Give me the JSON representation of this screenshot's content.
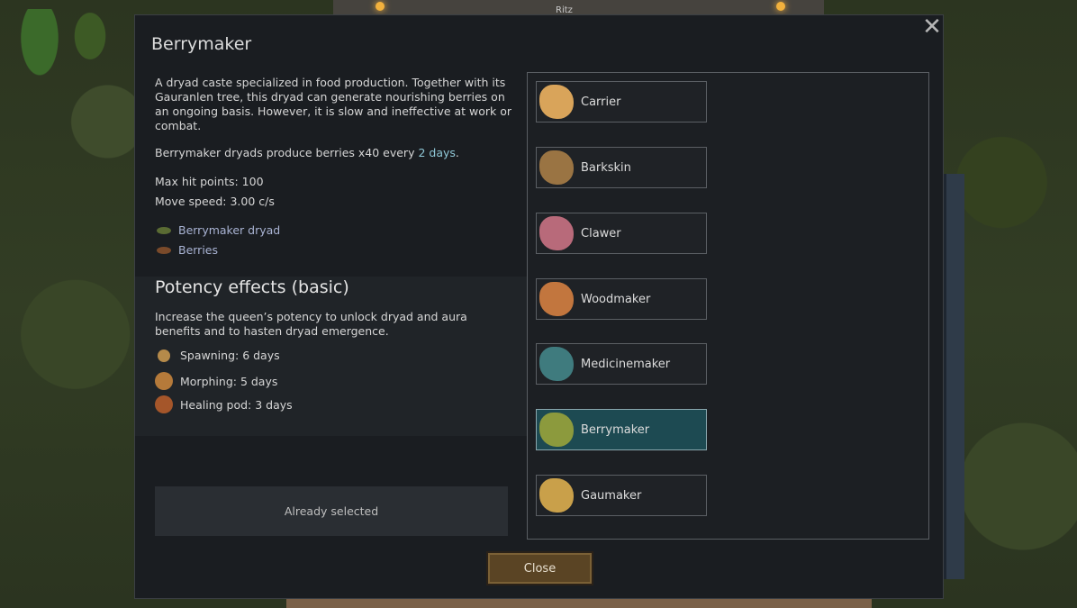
{
  "window": {
    "title": "Berrymaker",
    "close_glyph": "✕"
  },
  "background": {
    "pawn_name": "Ritz"
  },
  "details": {
    "description": "A dryad caste specialized in food production. Together with its Gauranlen tree, this dryad can generate nourishing berries on an ongoing basis. However, it is slow and ineffective at work or combat.",
    "produce_prefix": "Berrymaker dryads produce berries x40 every ",
    "produce_interval": "2 days",
    "produce_suffix": ".",
    "max_hp": "Max hit points: 100",
    "move_speed": "Move speed: 3.00 c/s",
    "links": [
      {
        "label": "Berrymaker dryad",
        "icon": "dryad-icon",
        "color": "#5a6b33"
      },
      {
        "label": "Berries",
        "icon": "berries-icon",
        "color": "#7a4a2a"
      }
    ]
  },
  "potency": {
    "title": "Potency effects (basic)",
    "description": "Increase the queen’s potency to unlock dryad and aura benefits and to hasten dryad emergence.",
    "effects": [
      {
        "label": "Spawning: 6 days",
        "icon": "spawning-icon",
        "color": "#b58a4a"
      },
      {
        "label": "Morphing: 5 days",
        "icon": "morphing-icon",
        "color": "#b57a3a"
      },
      {
        "label": "Healing pod: 3 days",
        "icon": "healing-pod-icon",
        "color": "#a5562a"
      }
    ]
  },
  "selected_button": "Already selected",
  "castes": [
    {
      "label": "Carrier",
      "icon": "carrier-icon",
      "color": "#d9a45a",
      "active": false
    },
    {
      "label": "Barkskin",
      "icon": "barkskin-icon",
      "color": "#9a7443",
      "active": false
    },
    {
      "label": "Clawer",
      "icon": "clawer-icon",
      "color": "#b86a7a",
      "active": false
    },
    {
      "label": "Woodmaker",
      "icon": "woodmaker-icon",
      "color": "#c2763e",
      "active": false
    },
    {
      "label": "Medicinemaker",
      "icon": "medicinemaker-icon",
      "color": "#3f7b7e",
      "active": false
    },
    {
      "label": "Berrymaker",
      "icon": "berrymaker-icon",
      "color": "#8c9a3d",
      "active": true
    },
    {
      "label": "Gaumaker",
      "icon": "gaumaker-icon",
      "color": "#c9a04a",
      "active": false
    }
  ],
  "close_button": "Close"
}
